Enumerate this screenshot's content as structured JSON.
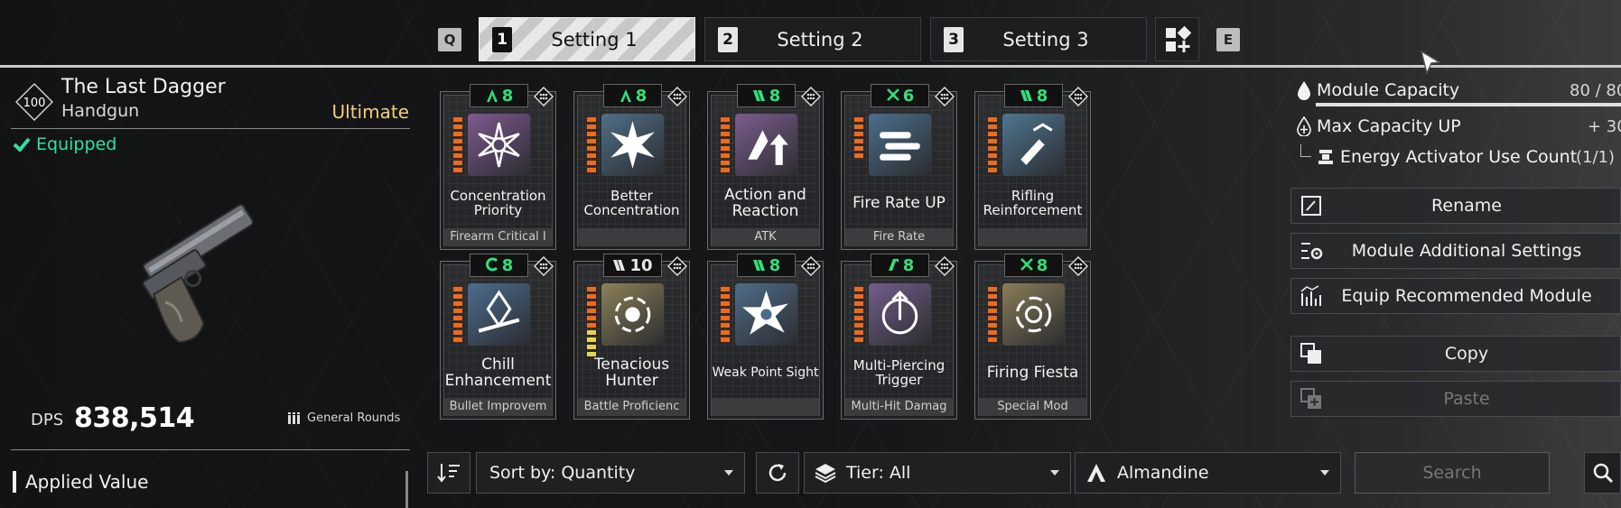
{
  "tabs": {
    "prev_key": "Q",
    "next_key": "E",
    "items": [
      {
        "num": "1",
        "label": "Setting 1",
        "active": true
      },
      {
        "num": "2",
        "label": "Setting 2",
        "active": false
      },
      {
        "num": "3",
        "label": "Setting 3",
        "active": false
      }
    ]
  },
  "weapon": {
    "level": "100",
    "name": "The Last Dagger",
    "type": "Handgun",
    "rarity": "Ultimate",
    "status": "Equipped",
    "dps_label": "DPS",
    "dps_value": "838,514",
    "ammo": "General Rounds"
  },
  "applied_value_label": "Applied Value",
  "modules": [
    {
      "name": "Concentration Priority",
      "type": "Firearm Critical I",
      "cap": "8",
      "socket": "almandine",
      "icon": "concentration-priority-icon",
      "color": "#7e5a8f"
    },
    {
      "name": "Better Concentration",
      "type": "",
      "cap": "8",
      "socket": "almandine",
      "icon": "better-concentration-icon",
      "color": "#4f6f86"
    },
    {
      "name": "Action and Reaction",
      "type": "ATK",
      "cap": "8",
      "socket": "rutile",
      "icon": "action-reaction-icon",
      "color": "#7c5d8d"
    },
    {
      "name": "Fire Rate UP",
      "type": "Fire Rate",
      "cap": "6",
      "socket": "cerulean",
      "icon": "fire-rate-icon",
      "color": "#4a6f8a"
    },
    {
      "name": "Rifling Reinforcement",
      "type": "",
      "cap": "8",
      "socket": "rutile",
      "icon": "rifling-icon",
      "color": "#4f7690"
    },
    {
      "name": "Chill Enhancement",
      "type": "Bullet Improvem",
      "cap": "8",
      "socket": "malachite",
      "icon": "chill-enhancement-icon",
      "color": "#4b6d8d"
    },
    {
      "name": "Tenacious Hunter",
      "type": "Battle Proficienc",
      "cap": "10",
      "socket": "rutile-white",
      "icon": "tenacious-hunter-icon",
      "color": "#8c8157"
    },
    {
      "name": "Weak Point Sight",
      "type": "",
      "cap": "8",
      "socket": "rutile",
      "icon": "weak-point-icon",
      "color": "#4e6c88"
    },
    {
      "name": "Multi-Piercing Trigger",
      "type": "Multi-Hit Damag",
      "cap": "8",
      "socket": "xantic",
      "icon": "multi-piercing-icon",
      "color": "#735d8a"
    },
    {
      "name": "Firing Fiesta",
      "type": "Special Mod",
      "cap": "8",
      "socket": "cerulean",
      "icon": "firing-fiesta-icon",
      "color": "#8a7d58"
    }
  ],
  "capacity": {
    "label": "Module Capacity",
    "value": "80 / 80",
    "fill": 1.0,
    "max_up_label": "Max Capacity UP",
    "max_up_value": "+ 30",
    "activator_label": "Energy Activator Use Count",
    "activator_value": "(1/1)"
  },
  "actions": {
    "rename": "Rename",
    "additional_settings": "Module Additional Settings",
    "equip_recommended": "Equip Recommended Module",
    "copy": "Copy",
    "paste": "Paste"
  },
  "toolbar": {
    "sort": "Sort by: Quantity",
    "tier": "Tier: All",
    "socket": "Almandine",
    "search_placeholder": "Search"
  },
  "colors": {
    "accent_green": "#33e0a0",
    "rarity_gold": "#f0cf7a",
    "socket_green": "#2fe07a"
  }
}
